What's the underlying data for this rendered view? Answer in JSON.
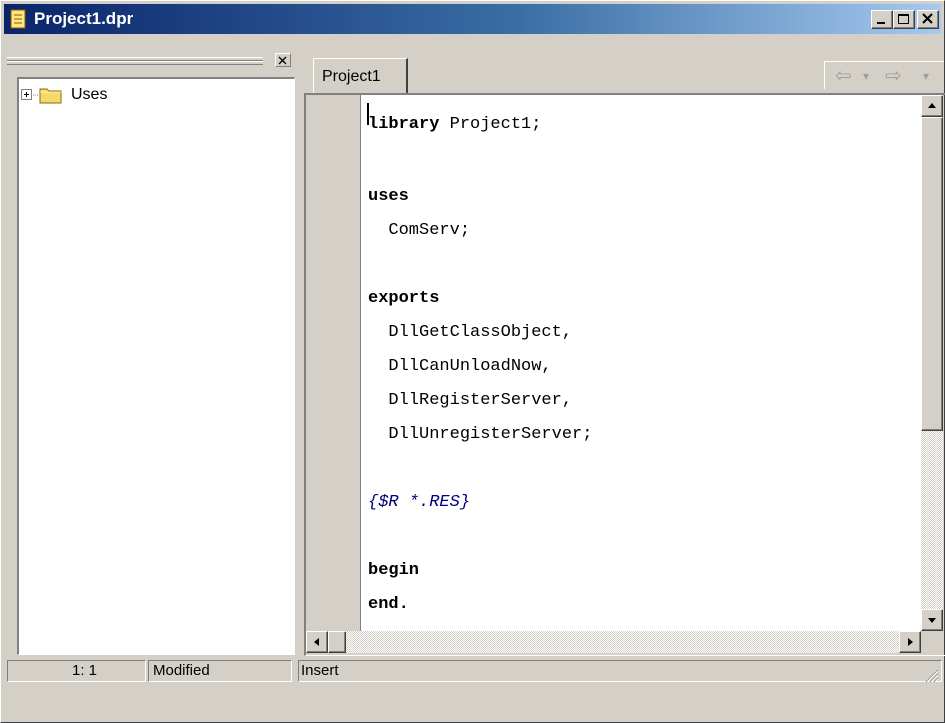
{
  "window": {
    "title": "Project1.dpr",
    "title_icon": "file-icon",
    "controls": [
      "minimize",
      "maximize",
      "close"
    ]
  },
  "tree": {
    "items": [
      {
        "label": "Uses",
        "expander": "plus-icon",
        "icon": "folder-icon"
      }
    ]
  },
  "tabs": [
    {
      "label": "Project1",
      "active": true
    }
  ],
  "nav": {
    "back": "arrow-left-icon",
    "forward": "arrow-right-icon"
  },
  "code": {
    "l1_kw": "library",
    "l1_rest": " Project1;",
    "l2_kw": "uses",
    "l3": "  ComServ;",
    "l4_kw": "exports",
    "l5": "  DllGetClassObject,",
    "l6": "  DllCanUnloadNow,",
    "l7": "  DllRegisterServer,",
    "l8": "  DllUnregisterServer;",
    "l9_dir": "{$R *.RES}",
    "l10_kw": "begin",
    "l11_kw": "end."
  },
  "status": {
    "position": "1:  1",
    "modified": "Modified",
    "mode": "Insert"
  },
  "colors": {
    "titlebar_start": "#0a246a",
    "titlebar_end": "#a6caf0",
    "directive": "#000080"
  }
}
